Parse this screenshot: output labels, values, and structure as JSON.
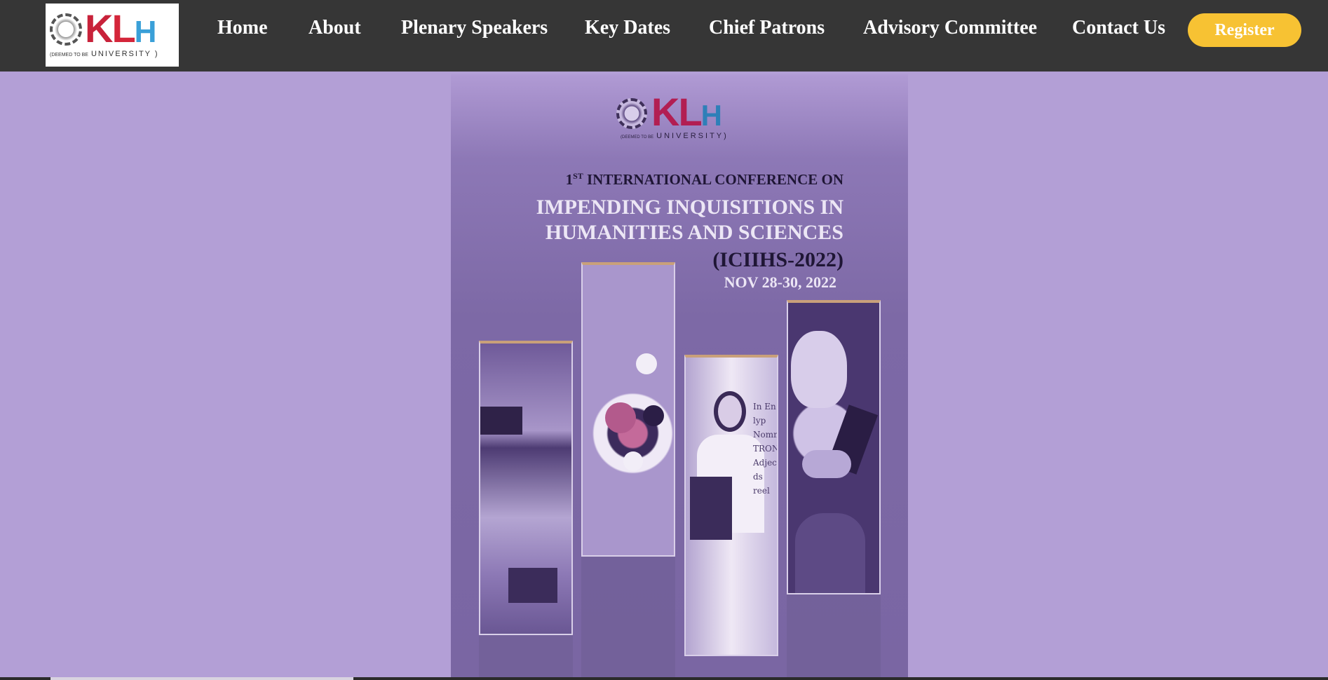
{
  "header": {
    "logo": {
      "name": "KLH",
      "letters_k": "K",
      "letters_l": "L",
      "letters_h": "H",
      "deemed": "(DEEMED TO BE",
      "university": "UNIVERSITY )"
    },
    "nav": [
      {
        "label": "Home"
      },
      {
        "label": "About"
      },
      {
        "label": "Plenary Speakers"
      },
      {
        "label": "Key Dates"
      },
      {
        "label": "Chief Patrons"
      },
      {
        "label": "Advisory Committee"
      },
      {
        "label": "Contact Us"
      }
    ],
    "register_label": "Register"
  },
  "poster": {
    "logo_letters": "KL",
    "logo_h": "H",
    "deemed": "(DEEMED TO BE",
    "university": "UNIVERSITY)",
    "line1_num": "1",
    "line1_sup": "ST",
    "line1_rest": " INTERNATIONAL CONFERENCE ON",
    "title_line1": "IMPENDING INQUISITIONS IN",
    "title_line2": "HUMANITIES AND SCIENCES",
    "abbr": "(ICIIHS-2022)",
    "date": "NOV 28-30, 2022",
    "board_text": "In En lyp Nomn TRONC Adject ds reel"
  },
  "colors": {
    "navbar": "#363636",
    "page_background": "#b39fd6",
    "register": "#f7c233",
    "klh_red": "#c8223a",
    "klh_blue": "#3aa0d8"
  },
  "icons": {
    "logo": "klh-university-logo",
    "seal": "university-seal-icon"
  }
}
